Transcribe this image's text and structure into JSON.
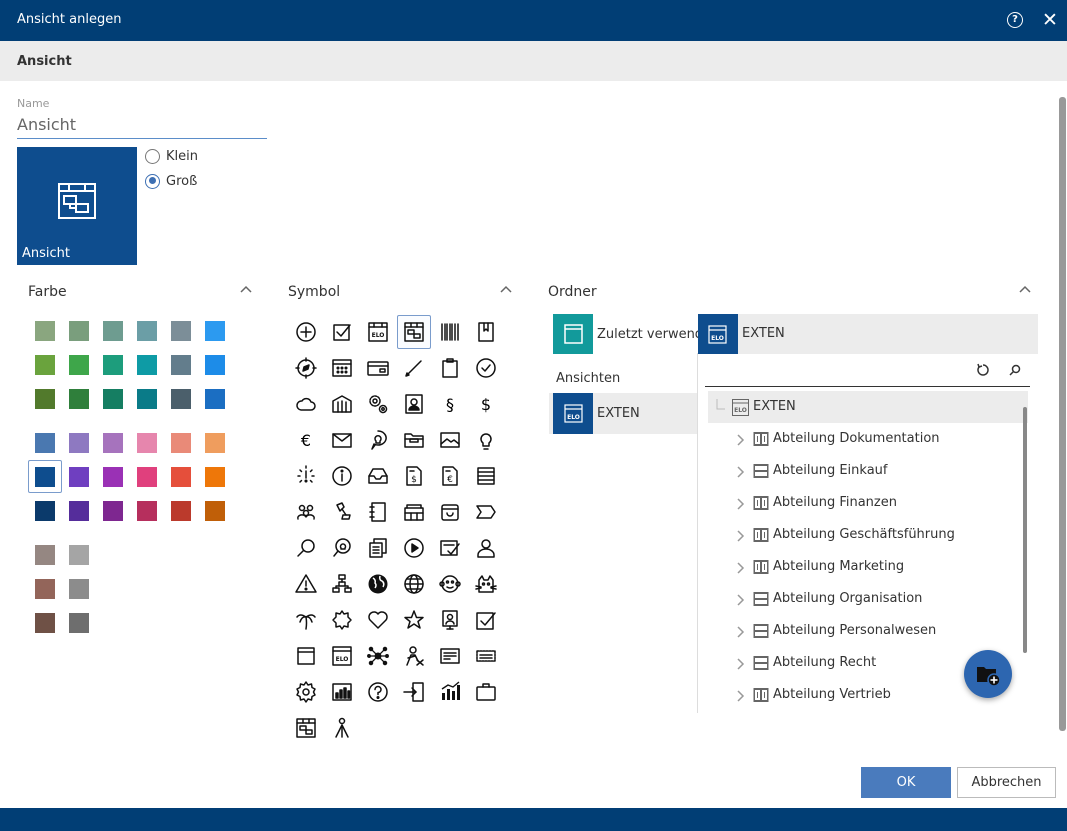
{
  "dialog": {
    "title": "Ansicht anlegen",
    "help_icon": "help-icon",
    "close_icon": "close-icon",
    "close_glyph": "✕",
    "help_glyph": "?"
  },
  "tabs": [
    {
      "label": "Ansicht",
      "active": true
    }
  ],
  "name_field": {
    "label": "Name",
    "value": "Ansicht"
  },
  "preview": {
    "label": "Ansicht",
    "icon": "view-icon",
    "color": "#0e4d8e"
  },
  "size_options": [
    {
      "label": "Klein",
      "checked": false
    },
    {
      "label": "Groß",
      "checked": true
    }
  ],
  "color_section": {
    "title": "Farbe",
    "selected": "#0e4d8e",
    "swatches": [
      "#8aa67f",
      "#7a9e7d",
      "#6e9c90",
      "#6b9ea6",
      "#7c8e98",
      "#2c9af0",
      "#6aa33d",
      "#3ea64a",
      "#1d9d7c",
      "#0e9ba5",
      "#637d8c",
      "#1d8ce8",
      "#527a2c",
      "#2f7f3b",
      "#157e62",
      "#0a7b88",
      "#4b5f6b",
      "#1b6ec2",
      "#4a78b0",
      "#8e79c1",
      "#a673bd",
      "#e686ad",
      "#e98a78",
      "#ef9d5e",
      "#0e4d8e",
      "#6f3fc0",
      "#9a31b5",
      "#e0407d",
      "#e54f3b",
      "#ee7709",
      "#0b3a6b",
      "#552d9b",
      "#7e2790",
      "#b62f5d",
      "#bb3a2c",
      "#c05f08",
      "#958782",
      "#a5a5a5",
      "#93655a",
      "#8c8c8c",
      "#6f5146",
      "#6e6e6e"
    ]
  },
  "symbol_section": {
    "title": "Symbol",
    "symbols": [
      "plus-circle",
      "checkbox",
      "elo-archive",
      "view",
      "barcode",
      "book",
      "compass",
      "calculator",
      "credit-card",
      "pen",
      "clipboard",
      "check-circle",
      "cloud",
      "building",
      "gears",
      "contact",
      "paragraph",
      "dollar",
      "euro",
      "envelope",
      "lightbulb-speech",
      "folder",
      "image",
      "lightbulb",
      "alert-lines",
      "info",
      "inbox",
      "invoice-dollar",
      "invoice-euro",
      "document-lines",
      "people",
      "stamp",
      "notebook",
      "register",
      "emoji-box",
      "label",
      "search",
      "search-bulb",
      "documents",
      "play-circle",
      "form-check",
      "person",
      "warning",
      "org-chart",
      "globe-filled",
      "globe",
      "monkey",
      "cat",
      "palm-tree",
      "sun",
      "heart",
      "star",
      "badge-screen",
      "check-box-square",
      "window",
      "elo-box",
      "network",
      "person-cross",
      "id-card",
      "ticket",
      "gear",
      "chart-box",
      "question-circle",
      "exit-door",
      "bar-chart",
      "briefcase",
      "view-small",
      "person-a"
    ],
    "selected": "view"
  },
  "folder_section": {
    "title": "Ordner",
    "recent": {
      "label": "Zuletzt verwendet",
      "color": "#129a9b"
    },
    "views_group": "Ansichten",
    "views": [
      {
        "label": "EXTEN"
      }
    ],
    "header": {
      "label": "EXTEN"
    },
    "tools": {
      "refresh_icon": "refresh-icon",
      "search_icon": "search-icon"
    },
    "tree": {
      "root": {
        "label": "EXTEN"
      },
      "items": [
        {
          "label": "Abteilung Dokumentation",
          "icon": "folder-file-icon"
        },
        {
          "label": "Abteilung Einkauf",
          "icon": "folder-cabinet-icon"
        },
        {
          "label": "Abteilung Finanzen",
          "icon": "folder-file-icon"
        },
        {
          "label": "Abteilung Geschäftsführung",
          "icon": "folder-file-icon"
        },
        {
          "label": "Abteilung Marketing",
          "icon": "folder-file-icon"
        },
        {
          "label": "Abteilung Organisation",
          "icon": "folder-cabinet-icon"
        },
        {
          "label": "Abteilung Personalwesen",
          "icon": "folder-cabinet-icon"
        },
        {
          "label": "Abteilung Recht",
          "icon": "folder-cabinet-icon"
        },
        {
          "label": "Abteilung Vertrieb",
          "icon": "folder-file-icon"
        }
      ]
    },
    "fab_icon": "new-folder-icon"
  },
  "footer": {
    "ok_label": "OK",
    "cancel_label": "Abbrechen"
  }
}
